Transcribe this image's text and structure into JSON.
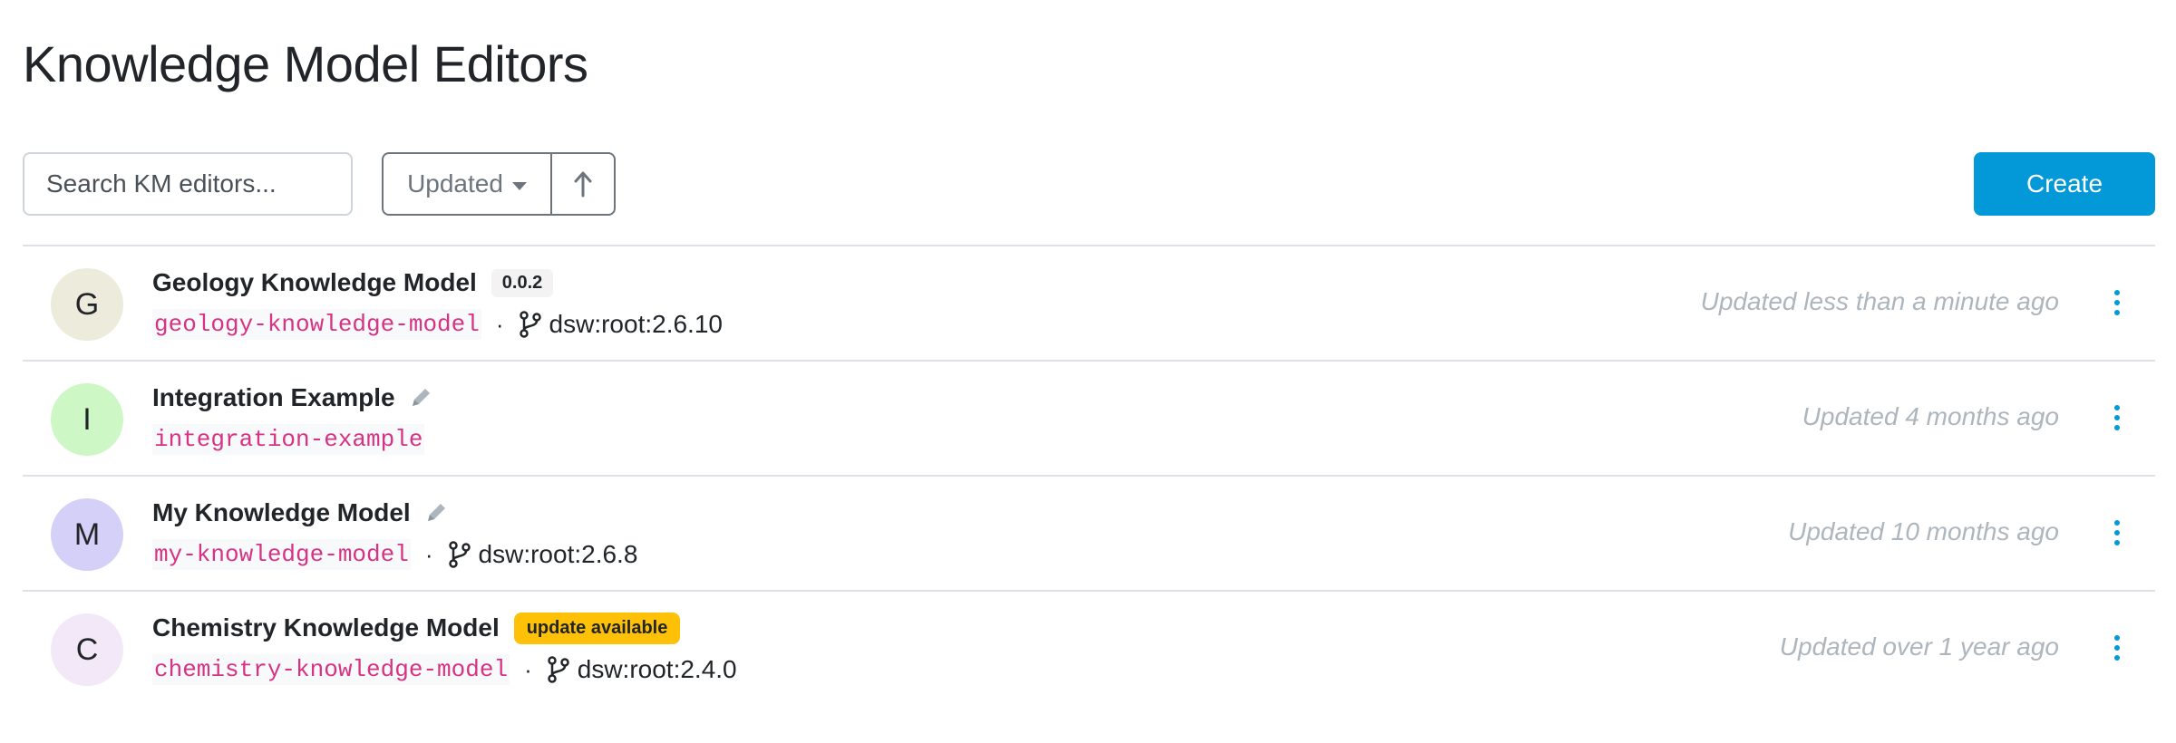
{
  "page": {
    "title": "Knowledge Model Editors"
  },
  "toolbar": {
    "search_placeholder": "Search KM editors...",
    "sort_label": "Updated",
    "sort_direction_icon": "arrow-up-icon",
    "create_label": "Create"
  },
  "colors": {
    "primary": "#0398d8",
    "id_pink": "#d63384",
    "update_badge": "#ffc107",
    "muted": "#adb5bd"
  },
  "editors": [
    {
      "initial": "G",
      "avatar_color": "#ecebdc",
      "name": "Geology Knowledge Model",
      "badge": "0.0.2",
      "badge_type": "version",
      "km_id": "geology-knowledge-model",
      "parent": "dsw:root:2.6.10",
      "updated": "Updated less than a minute ago"
    },
    {
      "initial": "I",
      "avatar_color": "#cdf7c5",
      "name": "Integration Example",
      "badge": null,
      "badge_type": "edit",
      "km_id": "integration-example",
      "parent": null,
      "updated": "Updated 4 months ago"
    },
    {
      "initial": "M",
      "avatar_color": "#d4d0f7",
      "name": "My Knowledge Model",
      "badge": null,
      "badge_type": "edit",
      "km_id": "my-knowledge-model",
      "parent": "dsw:root:2.6.8",
      "updated": "Updated 10 months ago"
    },
    {
      "initial": "C",
      "avatar_color": "#f2e8f7",
      "name": "Chemistry Knowledge Model",
      "badge": "update available",
      "badge_type": "update",
      "km_id": "chemistry-knowledge-model",
      "parent": "dsw:root:2.4.0",
      "updated": "Updated over 1 year ago"
    }
  ]
}
